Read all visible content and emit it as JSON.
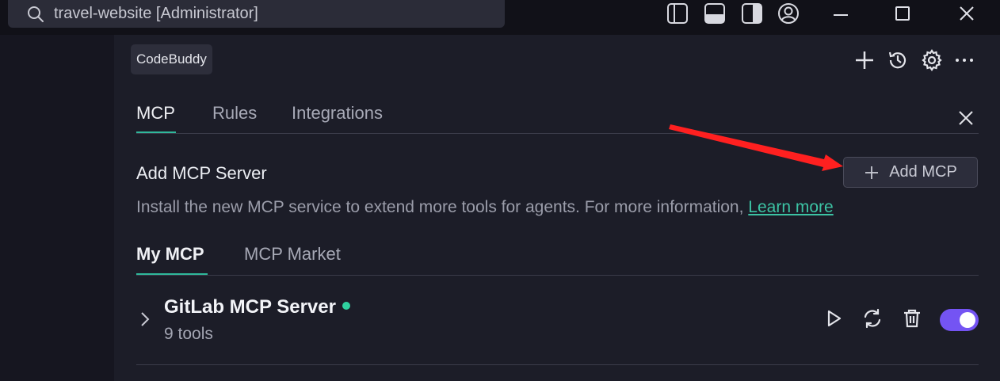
{
  "titlebar": {
    "search_text": "travel-website [Administrator]",
    "icons": [
      "search-icon",
      "toggle-primary-sidebar-icon",
      "toggle-panel-icon",
      "toggle-secondary-sidebar-icon",
      "account-icon",
      "minimize-icon",
      "maximize-icon",
      "close-icon"
    ]
  },
  "panel": {
    "chip_label": "CodeBuddy",
    "header_icons": [
      "plus-icon",
      "history-icon",
      "gear-icon",
      "more-icon"
    ],
    "tabs": [
      {
        "label": "MCP",
        "active": true
      },
      {
        "label": "Rules",
        "active": false
      },
      {
        "label": "Integrations",
        "active": false
      }
    ],
    "add_section": {
      "title": "Add MCP Server",
      "button_label": "Add MCP",
      "description": "Install the new MCP service to extend more tools for agents. For more information,",
      "link_label": "Learn more"
    },
    "subtabs": [
      {
        "label": "My MCP",
        "active": true
      },
      {
        "label": "MCP Market",
        "active": false
      }
    ],
    "servers": [
      {
        "name": "GitLab MCP Server",
        "tools_count": "9 tools",
        "status": "connected",
        "enabled": true
      }
    ]
  },
  "colors": {
    "accent": "#2fb89b",
    "toggle_on": "#7454f3",
    "status_dot": "#2fd19f",
    "annotation_arrow": "#ff2020"
  }
}
